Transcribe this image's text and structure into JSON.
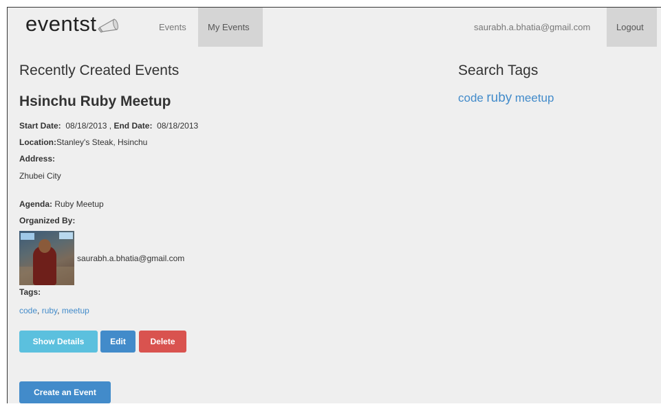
{
  "nav": {
    "brand": "eventst",
    "events": "Events",
    "my_events": "My Events",
    "user_email": "saurabh.a.bhatia@gmail.com",
    "logout": "Logout"
  },
  "main": {
    "section_title": "Recently Created Events",
    "event": {
      "name": "Hsinchu Ruby Meetup",
      "start_label": "Start Date:",
      "start_value": "08/18/2013",
      "separator": ",",
      "end_label": "End Date:",
      "end_value": "08/18/2013",
      "location_label": "Location:",
      "location_value": "Stanley's Steak, Hsinchu",
      "address_label": "Address:",
      "address_value": "Zhubei City",
      "agenda_label": "Agenda:",
      "agenda_value": "Ruby Meetup",
      "organized_label": "Organized By:",
      "organizer_email": "saurabh.a.bhatia@gmail.com",
      "tags_label": "Tags:",
      "tags": [
        "code",
        "ruby",
        "meetup"
      ],
      "tag_sep": ", "
    },
    "buttons": {
      "show_details": "Show Details",
      "edit": "Edit",
      "delete": "Delete",
      "create": "Create an Event"
    }
  },
  "sidebar": {
    "title": "Search Tags",
    "tags": [
      "code",
      "ruby",
      "meetup"
    ]
  },
  "colors": {
    "info": "#5bc0de",
    "primary": "#428bca",
    "danger": "#d9534f",
    "link": "#428bca"
  },
  "icons": {
    "brand": "megaphone-icon"
  }
}
